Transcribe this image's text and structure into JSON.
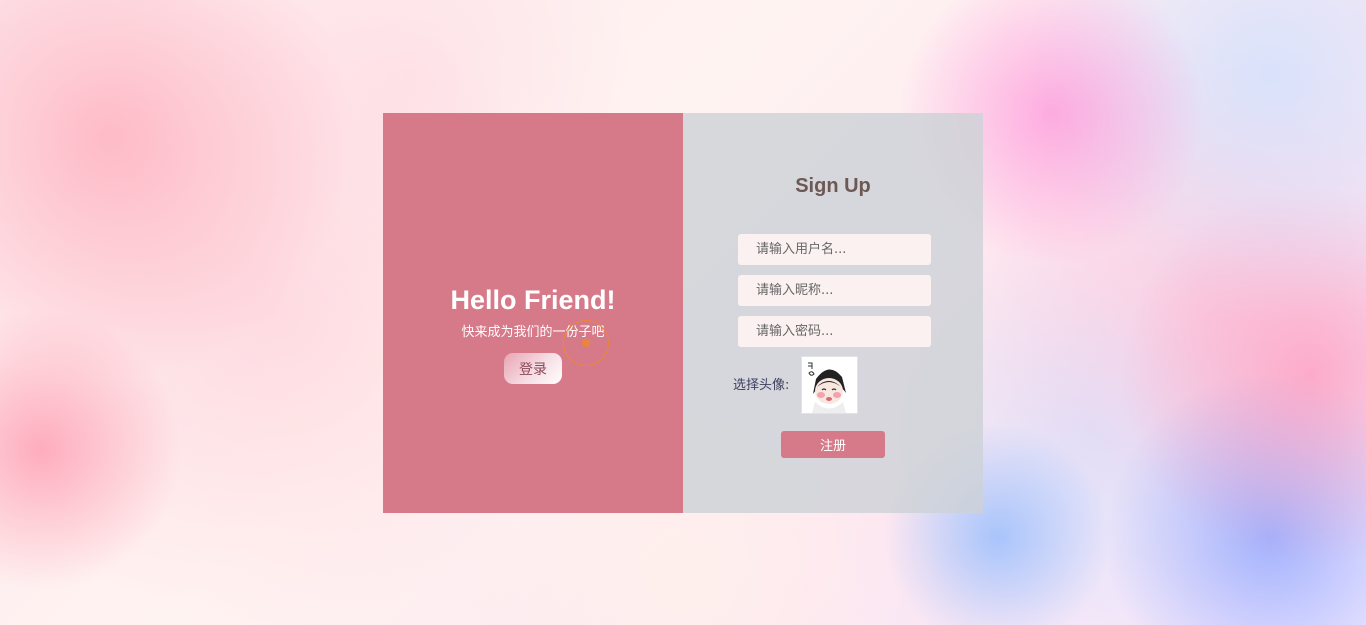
{
  "welcome": {
    "title": "Hello Friend!",
    "subtitle": "快来成为我们的一份子吧",
    "login_button": "登录"
  },
  "signup": {
    "title": "Sign Up",
    "username_placeholder": "请输入用户名...",
    "nickname_placeholder": "请输入昵称...",
    "password_placeholder": "请输入密码...",
    "avatar_label": "选择头像:",
    "register_button": "注册"
  },
  "colors": {
    "accent": "#d67a8a",
    "cursor": "#e9863a"
  }
}
